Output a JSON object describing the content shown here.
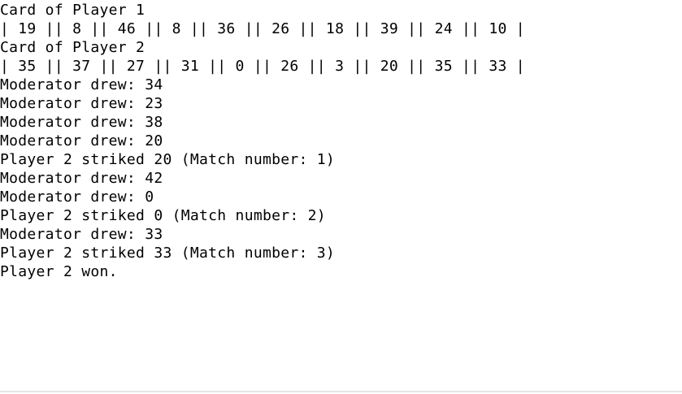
{
  "console": {
    "lines": [
      "Card of Player 1",
      "| 19 || 8 || 46 || 8 || 36 || 26 || 18 || 39 || 24 || 10 |",
      "Card of Player 2",
      "| 35 || 37 || 27 || 31 || 0 || 26 || 3 || 20 || 35 || 33 |",
      "Moderator drew: 34",
      "Moderator drew: 23",
      "Moderator drew: 38",
      "Moderator drew: 20",
      "Player 2 striked 20 (Match number: 1)",
      "Moderator drew: 42",
      "Moderator drew: 0",
      "Player 2 striked 0 (Match number: 2)",
      "Moderator drew: 33",
      "Player 2 striked 33 (Match number: 3)",
      "Player 2 won."
    ]
  }
}
